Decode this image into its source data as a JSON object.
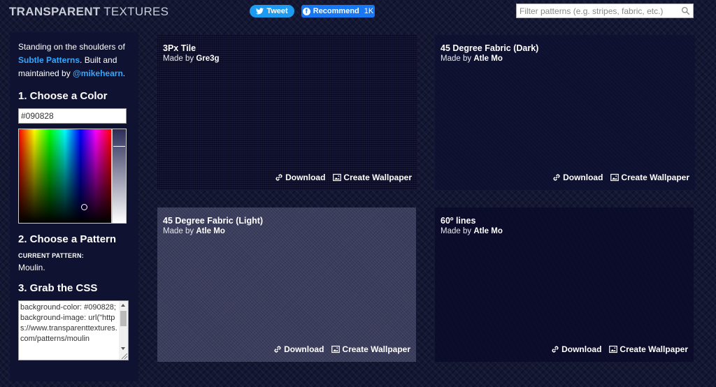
{
  "header": {
    "logo_bold": "TRANSPARENT",
    "logo_light": "TEXTURES",
    "tweet_label": "Tweet",
    "recommend_label": "Recommend",
    "recommend_count": "1K",
    "search_placeholder": "Filter patterns (e.g. stripes, fabric, etc.)"
  },
  "sidebar": {
    "intro_text_1": "Standing on the shoulders of ",
    "intro_link_1": "Subtle Patterns",
    "intro_text_2": ". Built and maintained by ",
    "intro_link_2": "@mikehearn",
    "intro_text_3": ".",
    "step1_title": "1. Choose a Color",
    "color_value": "#090828",
    "step2_title": "2. Choose a Pattern",
    "current_pattern_label": "CURRENT PATTERN:",
    "current_pattern_value": "Moulin.",
    "step3_title": "3. Grab the CSS",
    "css_text": "background-color: #090828;\nbackground-image: url(\"https://www.transparenttextures.com/patterns/moulin"
  },
  "patterns": [
    {
      "title": "3Px Tile",
      "made_by": "Made by",
      "author": "Gre3g",
      "download": "Download",
      "wallpaper": "Create Wallpaper"
    },
    {
      "title": "45 Degree Fabric (Dark)",
      "made_by": "Made by",
      "author": "Atle Mo",
      "download": "Download",
      "wallpaper": "Create Wallpaper"
    },
    {
      "title": "45 Degree Fabric (Light)",
      "made_by": "Made by",
      "author": "Atle Mo",
      "download": "Download",
      "wallpaper": "Create Wallpaper"
    },
    {
      "title": "60º lines",
      "made_by": "Made by",
      "author": "Atle Mo",
      "download": "Download",
      "wallpaper": "Create Wallpaper"
    }
  ],
  "colors": {
    "page_bg": "#131733",
    "link": "#35a7ff",
    "tweet": "#1d9bf0",
    "facebook": "#1877f2"
  }
}
